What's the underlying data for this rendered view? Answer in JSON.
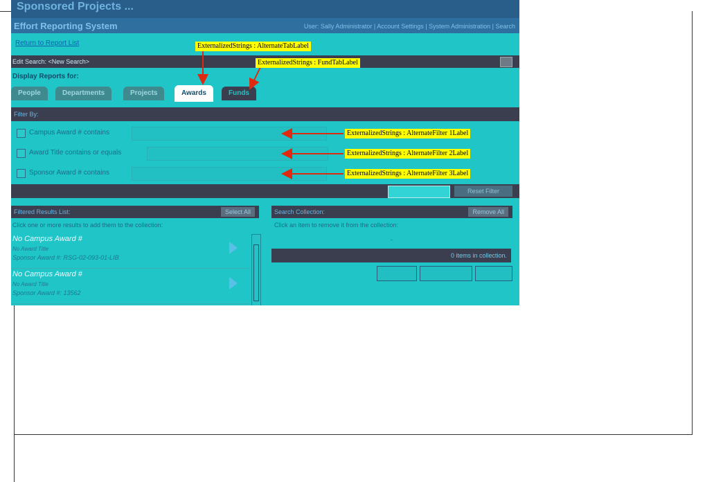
{
  "screenshot": {
    "title": "Sponsored Projects ...",
    "system_title": "Effort Reporting System",
    "system_links": "User: Sally Administrator | Account Settings | System Administration | Search",
    "return_link": "Return to Report List",
    "edit_search": "Edit Search: <New Search>",
    "display_for": "Display Reports for:",
    "tabs": [
      "People",
      "Departments",
      "Projects",
      "Awards",
      "Funds"
    ],
    "filter_header": "Filter By:",
    "filters": [
      {
        "label": "Campus Award # contains"
      },
      {
        "label": "Award Title contains or equals"
      },
      {
        "label": "Sponsor Award # contains"
      }
    ],
    "reset_button": "Reset Filter",
    "results_header": "Filtered Results List:",
    "select_all": "Select All",
    "results_hint": "Click one or more results to add them to the collection:",
    "results": [
      {
        "title": "No Campus Award #",
        "subtitle": "No Award Title",
        "sponsor": "Sponsor Award #: RSG-02-093-01-LIB"
      },
      {
        "title": "No Campus Award #",
        "subtitle": "No Award Title",
        "sponsor": "Sponsor Award #: 13562"
      }
    ],
    "collection_header": "Search Collection:",
    "remove_all": "Remove All",
    "collection_hint": "Click an item to remove it from the collection:",
    "collection_dash": "-",
    "collection_count": "0 items in collection."
  },
  "annotations": {
    "alternate_tab": "ExternalizedStrings : AlternateTabLabel",
    "fund_tab": "ExternalizedStrings : FundTabLabel",
    "filter1": "ExternalizedStrings : AlternateFilter 1Label",
    "filter2": "ExternalizedStrings : AlternateFilter 2Label",
    "filter3": "ExternalizedStrings : AlternateFilter 3Label"
  },
  "colors": {
    "background": "#1fc5c7",
    "bars": "#3a3e4e",
    "annotation": "#ffff00",
    "arrow": "#e02a10"
  }
}
